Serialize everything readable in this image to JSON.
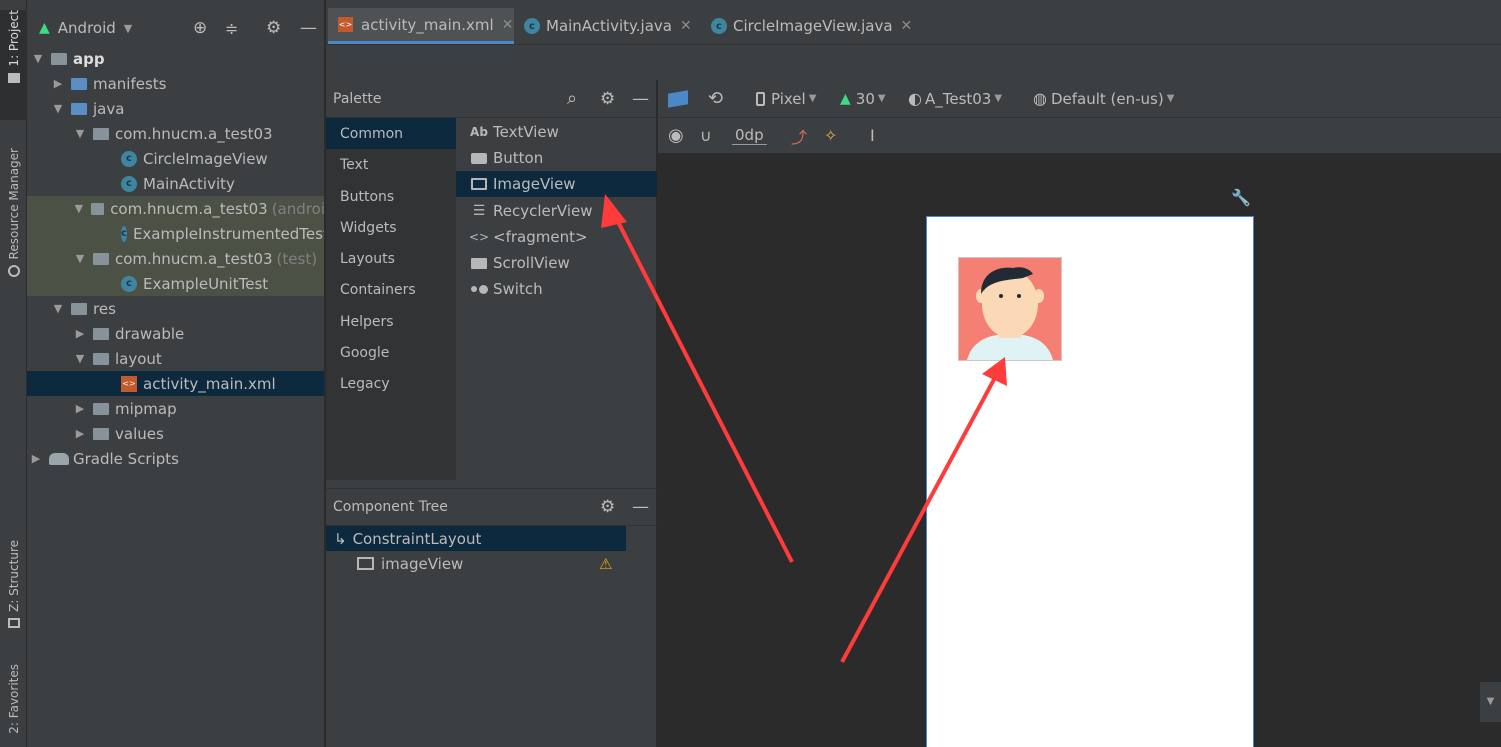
{
  "left_strip": {
    "project_tab": "1: Project",
    "resource_manager_tab": "Resource Manager",
    "structure_tab": "Z: Structure",
    "favorites_tab": "2: Favorites"
  },
  "project_panel": {
    "view_label": "Android",
    "tree": [
      {
        "label": "app",
        "suffix": ""
      },
      {
        "label": "manifests",
        "suffix": ""
      },
      {
        "label": "java",
        "suffix": ""
      },
      {
        "label": "com.hnucm.a_test03",
        "suffix": ""
      },
      {
        "label": "CircleImageView",
        "suffix": ""
      },
      {
        "label": "MainActivity",
        "suffix": ""
      },
      {
        "label": "com.hnucm.a_test03",
        "suffix": "(androi"
      },
      {
        "label": "ExampleInstrumentedTest",
        "suffix": ""
      },
      {
        "label": "com.hnucm.a_test03",
        "suffix": "(test)"
      },
      {
        "label": "ExampleUnitTest",
        "suffix": ""
      },
      {
        "label": "res",
        "suffix": ""
      },
      {
        "label": "drawable",
        "suffix": ""
      },
      {
        "label": "layout",
        "suffix": ""
      },
      {
        "label": "activity_main.xml",
        "suffix": ""
      },
      {
        "label": "mipmap",
        "suffix": ""
      },
      {
        "label": "values",
        "suffix": ""
      },
      {
        "label": "Gradle Scripts",
        "suffix": ""
      }
    ]
  },
  "editor_tabs": [
    {
      "label": "activity_main.xml"
    },
    {
      "label": "MainActivity.java"
    },
    {
      "label": "CircleImageView.java"
    }
  ],
  "palette": {
    "title": "Palette",
    "categories": [
      "Common",
      "Text",
      "Buttons",
      "Widgets",
      "Layouts",
      "Containers",
      "Helpers",
      "Google",
      "Legacy"
    ],
    "items": [
      {
        "label": "TextView",
        "icon_text": "Ab"
      },
      {
        "label": "Button"
      },
      {
        "label": "ImageView"
      },
      {
        "label": "RecyclerView"
      },
      {
        "label": "<fragment>",
        "icon_text": "<>"
      },
      {
        "label": "ScrollView"
      },
      {
        "label": "Switch"
      }
    ]
  },
  "component_tree": {
    "title": "Component Tree",
    "items": [
      {
        "label": "ConstraintLayout"
      },
      {
        "label": "imageView"
      }
    ]
  },
  "design_toolbar": {
    "device": "Pixel",
    "api_level": "30",
    "theme": "A_Test03",
    "locale": "Default (en-us)",
    "margin_value": "0dp"
  },
  "colors": {
    "accent": "#4a88c7",
    "selection": "#0d293e",
    "annotation_arrow": "#ff3b3b",
    "warning": "#f0a30a"
  }
}
